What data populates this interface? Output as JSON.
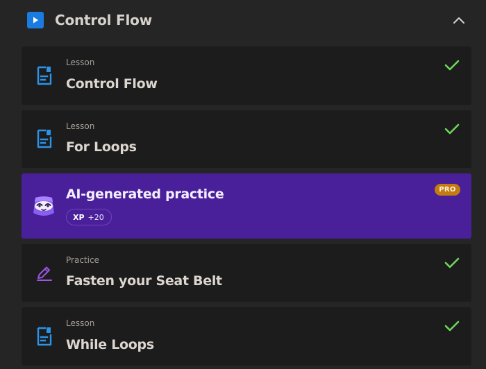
{
  "section": {
    "title": "Control Flow",
    "icon": "play-icon",
    "collapse_icon": "chevron-up-icon",
    "accent": "#1a7ce0"
  },
  "items": [
    {
      "kind": "Lesson",
      "title": "Control Flow",
      "icon": "document-icon",
      "completed": true
    },
    {
      "kind": "Lesson",
      "title": "For Loops",
      "icon": "document-icon",
      "completed": true
    },
    {
      "title": "AI-generated practice",
      "icon": "robot-mascot-icon",
      "xp_label": "XP",
      "xp_value": "+20",
      "pro_label": "PRO",
      "background": "#4a1f9a"
    },
    {
      "kind": "Practice",
      "title": "Fasten your Seat Belt",
      "icon": "pencil-icon",
      "completed": true
    },
    {
      "kind": "Lesson",
      "title": "While Loops",
      "icon": "document-icon",
      "completed": true
    }
  ],
  "colors": {
    "check": "#6fd65c",
    "lesson_icon": "#2b93e8",
    "practice_icon": "#9a56e3",
    "pro_badge": "#c47c10"
  }
}
